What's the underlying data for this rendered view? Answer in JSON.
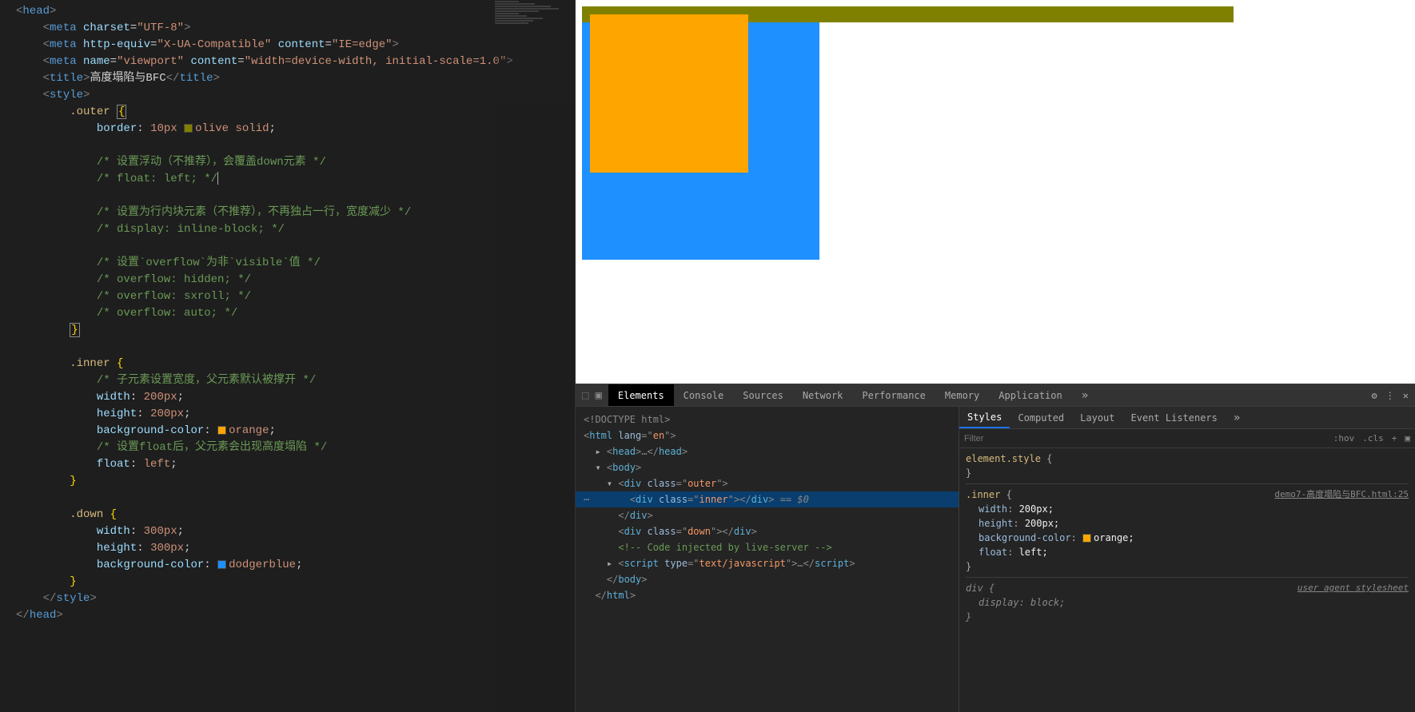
{
  "code": {
    "l1_open": "<",
    "l1_tag": "head",
    "l1_close": ">",
    "l2_open": "<",
    "l2_tag": "meta ",
    "l2_a1": "charset",
    "l2_eq": "=",
    "l2_v1": "\"UTF-8\"",
    "l2_close": ">",
    "l3_open": "<",
    "l3_tag": "meta ",
    "l3_a1": "http-equiv",
    "l3_v1": "\"X-UA-Compatible\" ",
    "l3_a2": "content",
    "l3_v2": "\"IE=edge\"",
    "l3_close": ">",
    "l4_open": "<",
    "l4_tag": "meta ",
    "l4_a1": "name",
    "l4_v1": "\"viewport\" ",
    "l4_a2": "content",
    "l4_v2": "\"width=device-width, initial-scale=1.0\"",
    "l4_close": ">",
    "l5_open": "<",
    "l5_tag": "title",
    "l5_close1": ">",
    "l5_text": "高度塌陷与BFC",
    "l5_open2": "</",
    "l5_close2": ">",
    "l6_open": "<",
    "l6_tag": "style",
    "l6_close": ">",
    "l7_sel": ".outer ",
    "l7_brace": "{",
    "l8_prop": "border",
    "l8_colon": ": ",
    "l8_v1": "10px ",
    "l8_v2": "olive ",
    "l8_v3": "solid",
    "l8_semi": ";",
    "l9_cmt": "/* 设置浮动（不推荐），会覆盖down元素 */",
    "l10_cmt": "/* float: left; */",
    "l11_cmt": "/* 设置为行内块元素（不推荐），不再独占一行，宽度减少 */",
    "l12_cmt": "/* display: inline-block; */",
    "l13_cmt": "/* 设置`overflow`为非`visible`值 */",
    "l14_cmt": "/* overflow: hidden; */",
    "l15_cmt": "/* overflow: sxroll; */",
    "l16_cmt": "/* overflow: auto; */",
    "l17_brace": "}",
    "l18_sel": ".inner ",
    "l18_brace": "{",
    "l19_cmt": "/* 子元素设置宽度，父元素默认被撑开 */",
    "l20_prop": "width",
    "l20_val": "200px",
    "l21_prop": "height",
    "l21_val": "200px",
    "l22_prop": "background-color",
    "l22_val": "orange",
    "l23_cmt": "/* 设置float后，父元素会出现高度塌陷 */",
    "l24_prop": "float",
    "l24_val": "left",
    "l25_brace": "}",
    "l26_sel": ".down ",
    "l26_brace": "{",
    "l27_prop": "width",
    "l27_val": "300px",
    "l28_prop": "height",
    "l28_val": "300px",
    "l29_prop": "background-color",
    "l29_val": "dodgerblue",
    "l30_brace": "}",
    "l31_open": "</",
    "l31_tag": "style",
    "l31_close": ">",
    "l32_open": "</",
    "l32_tag": "head",
    "l32_close": ">"
  },
  "devtools": {
    "tabs": {
      "elements": "Elements",
      "console": "Console",
      "sources": "Sources",
      "network": "Network",
      "performance": "Performance",
      "memory": "Memory",
      "application": "Application"
    },
    "dom": {
      "doctype": "<!DOCTYPE html>",
      "html_open": "<html lang=\"en\">",
      "head": "▸ <head>…</head>",
      "body_open": "▾ <body>",
      "outer_open": "▾ <div class=\"outer\">",
      "inner": "      <div class=\"inner\"></div>",
      "inner_sel": " == $0",
      "outer_close": "  </div>",
      "down": "  <div class=\"down\"></div>",
      "comment": "  <!-- Code injected by live-server -->",
      "script": "▸ <script type=\"text/javascript\">…</scr",
      "script_end": "ipt>",
      "body_close": "</body>",
      "html_close": "</html>"
    },
    "stylesTabs": {
      "styles": "Styles",
      "computed": "Computed",
      "layout": "Layout",
      "eventlisteners": "Event Listeners"
    },
    "filter": {
      "placeholder": "Filter",
      "hov": ":hov",
      "cls": ".cls"
    },
    "rules": {
      "elstyle_sel": "element.style ",
      "elstyle_open": "{",
      "elstyle_close": "}",
      "inner_sel": ".inner ",
      "inner_open": "{",
      "inner_src": "demo7-高度塌陷与BFC.html:25",
      "r1p": "width",
      "r1v": "200px;",
      "r2p": "height",
      "r2v": "200px;",
      "r3p": "background-color",
      "r3v": "orange;",
      "r4p": "float",
      "r4v": "left;",
      "inner_close": "}",
      "div_sel": "div ",
      "div_open": "{",
      "div_src": "user agent stylesheet",
      "r5p": "display",
      "r5v": "block;",
      "div_close": "}"
    }
  }
}
